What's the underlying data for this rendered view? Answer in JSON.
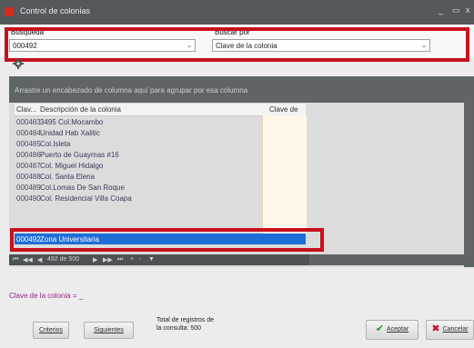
{
  "window": {
    "title": "Control de colonias",
    "minimize": "_",
    "maximize": "▭",
    "close": "x"
  },
  "search": {
    "busqueda_label": "Busqueda",
    "busqueda_value": "000492",
    "buscar_por_label": "Buscar por",
    "buscar_por_value": "Clave de la colonia"
  },
  "grid": {
    "group_hint": "Arrastre un encabezado de columna aquí para agrupar por esa columna",
    "columns": [
      "Clav...",
      "Descripción de la colonia",
      "Clave de ..."
    ],
    "rows": [
      {
        "clave": "000483",
        "desc": "3495 Col.Mocambo"
      },
      {
        "clave": "000484",
        "desc": "Unidad Hab Xalitic"
      },
      {
        "clave": "000485",
        "desc": "Col.Isleta"
      },
      {
        "clave": "000486",
        "desc": "Puerto de Guaymas #16"
      },
      {
        "clave": "000487",
        "desc": "Col. Miguel Hidalgo"
      },
      {
        "clave": "000488",
        "desc": "Col. Santa Elena"
      },
      {
        "clave": "000489",
        "desc": "Col.Lomas De San Roque"
      },
      {
        "clave": "000490",
        "desc": "Col. Residencial Villa Coapa"
      },
      {
        "clave": "000492",
        "desc": "Zona Universitaria"
      }
    ],
    "selected_index": 8,
    "nav": {
      "first": "⏮",
      "prev_page": "◀◀",
      "prev": "◀",
      "position": "492 de 500",
      "next": "▶",
      "next_page": "▶▶",
      "last": "⏭",
      "add": "+",
      "remove": "-",
      "filter": "▼"
    }
  },
  "filter_text": "Clave de la colonia = _",
  "footer": {
    "criterios": "Criterios",
    "siguientes": "Siguientes",
    "total_label_1": "Total de registros de",
    "total_label_2": "la consulta:",
    "total_value": "500",
    "aceptar": "Aceptar",
    "cancelar": "Cancelar"
  },
  "colors": {
    "highlight": "#c8101e",
    "selection": "#1e6ed8"
  }
}
